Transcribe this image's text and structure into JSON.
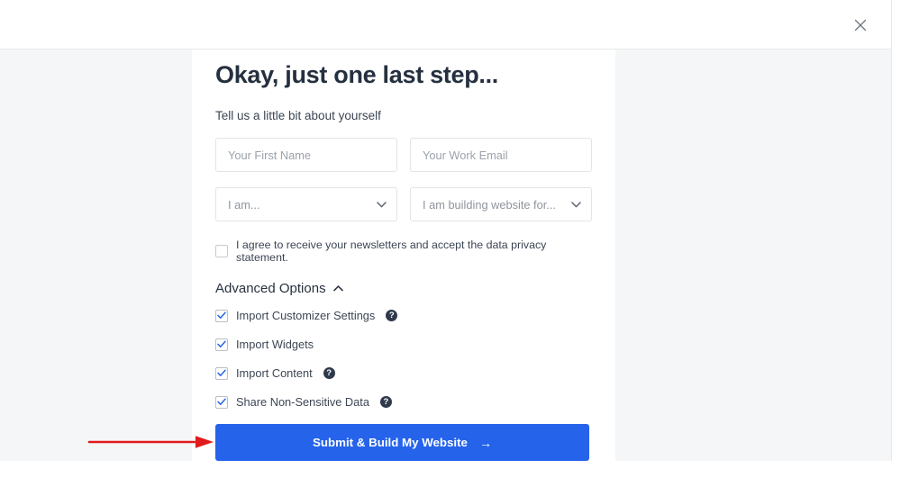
{
  "topbar": {
    "close_icon": "close-icon"
  },
  "card": {
    "title": "Okay, just one last step...",
    "subtitle": "Tell us a little bit about yourself",
    "fields": {
      "first_name": {
        "placeholder": "Your First Name",
        "value": ""
      },
      "work_email": {
        "placeholder": "Your Work Email",
        "value": ""
      },
      "role_select": {
        "selected": "I am...",
        "icon": "chevron-down-icon"
      },
      "purpose_select": {
        "selected": "I am building website for...",
        "icon": "chevron-down-icon"
      }
    },
    "consent": {
      "label": "I agree to receive your newsletters and accept the data privacy statement.",
      "checked": false
    },
    "advanced": {
      "title": "Advanced Options",
      "expanded": true,
      "toggle_icon": "chevron-up-icon",
      "options": [
        {
          "label": "Import Customizer Settings",
          "checked": true,
          "help": true,
          "help_icon": "help-circle-icon"
        },
        {
          "label": "Import Widgets",
          "checked": true,
          "help": false
        },
        {
          "label": "Import Content",
          "checked": true,
          "help": true,
          "help_icon": "help-circle-icon"
        },
        {
          "label": "Share Non-Sensitive Data",
          "checked": true,
          "help": true,
          "help_icon": "help-circle-icon"
        }
      ]
    },
    "submit": {
      "label": "Submit & Build My Website",
      "arrow": "→"
    }
  },
  "annotation": {
    "arrow_icon": "red-pointer-arrow",
    "color": "#e01b1b"
  },
  "colors": {
    "accent_blue": "#2563eb",
    "heading": "#25303f",
    "body_text": "#3c4654",
    "placeholder": "#9ba2ab",
    "page_bg": "#f5f6f7",
    "card_bg": "#ffffff",
    "border": "#e2e4e7",
    "help_badge": "#2f3a4c"
  }
}
